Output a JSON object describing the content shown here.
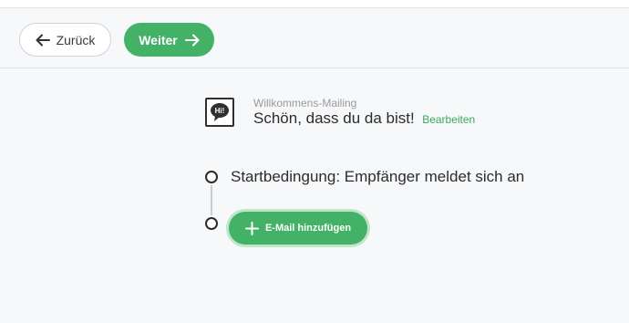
{
  "toolbar": {
    "back_label": "Zurück",
    "next_label": "Weiter"
  },
  "mailing": {
    "icon_text": "Hi!",
    "subtitle": "Willkommens-Mailing",
    "title": "Schön, dass du da bist!",
    "edit_label": "Bearbeiten"
  },
  "flow": {
    "start_condition": "Startbedingung: Empfänger meldet sich an",
    "add_email_label": "E-Mail hinzufügen"
  },
  "colors": {
    "accent": "#43b166",
    "link": "#3aa85c",
    "background": "#f7f8fa"
  },
  "icons": [
    "arrow-left-icon",
    "arrow-right-icon",
    "speech-bubble-icon",
    "plus-icon"
  ]
}
